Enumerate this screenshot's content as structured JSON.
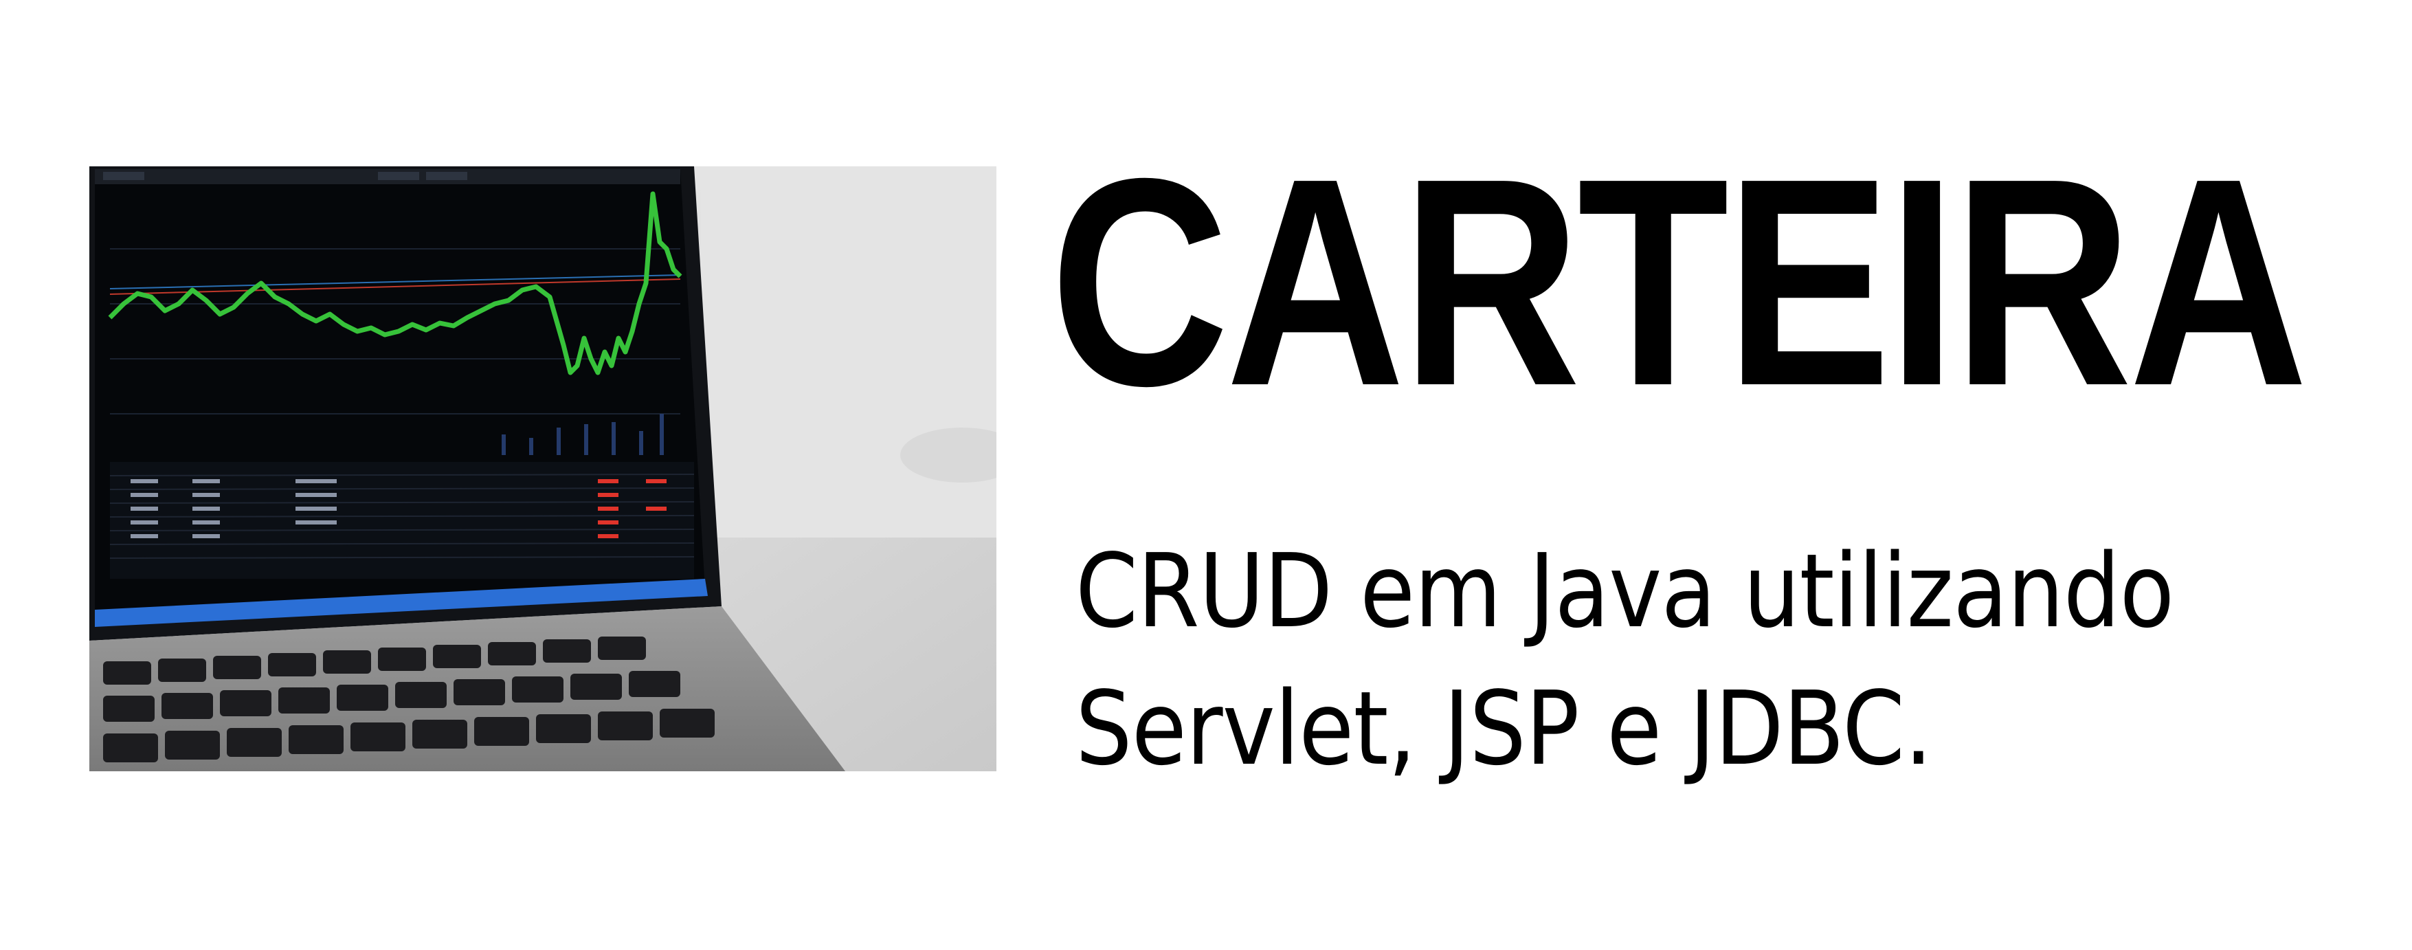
{
  "image": {
    "description_icon": "laptop-stock-chart-photo",
    "colors": {
      "chart_line": "#37c23a",
      "screen_bg": "#05070a",
      "negative_values": "#e0342b"
    }
  },
  "heading": {
    "title": "CARTEIRA",
    "subtitle_line1": "CRUD em Java utilizando",
    "subtitle_line2": "Servlet, JSP e JDBC."
  },
  "colors": {
    "background": "#ffffff",
    "text": "#000000"
  }
}
